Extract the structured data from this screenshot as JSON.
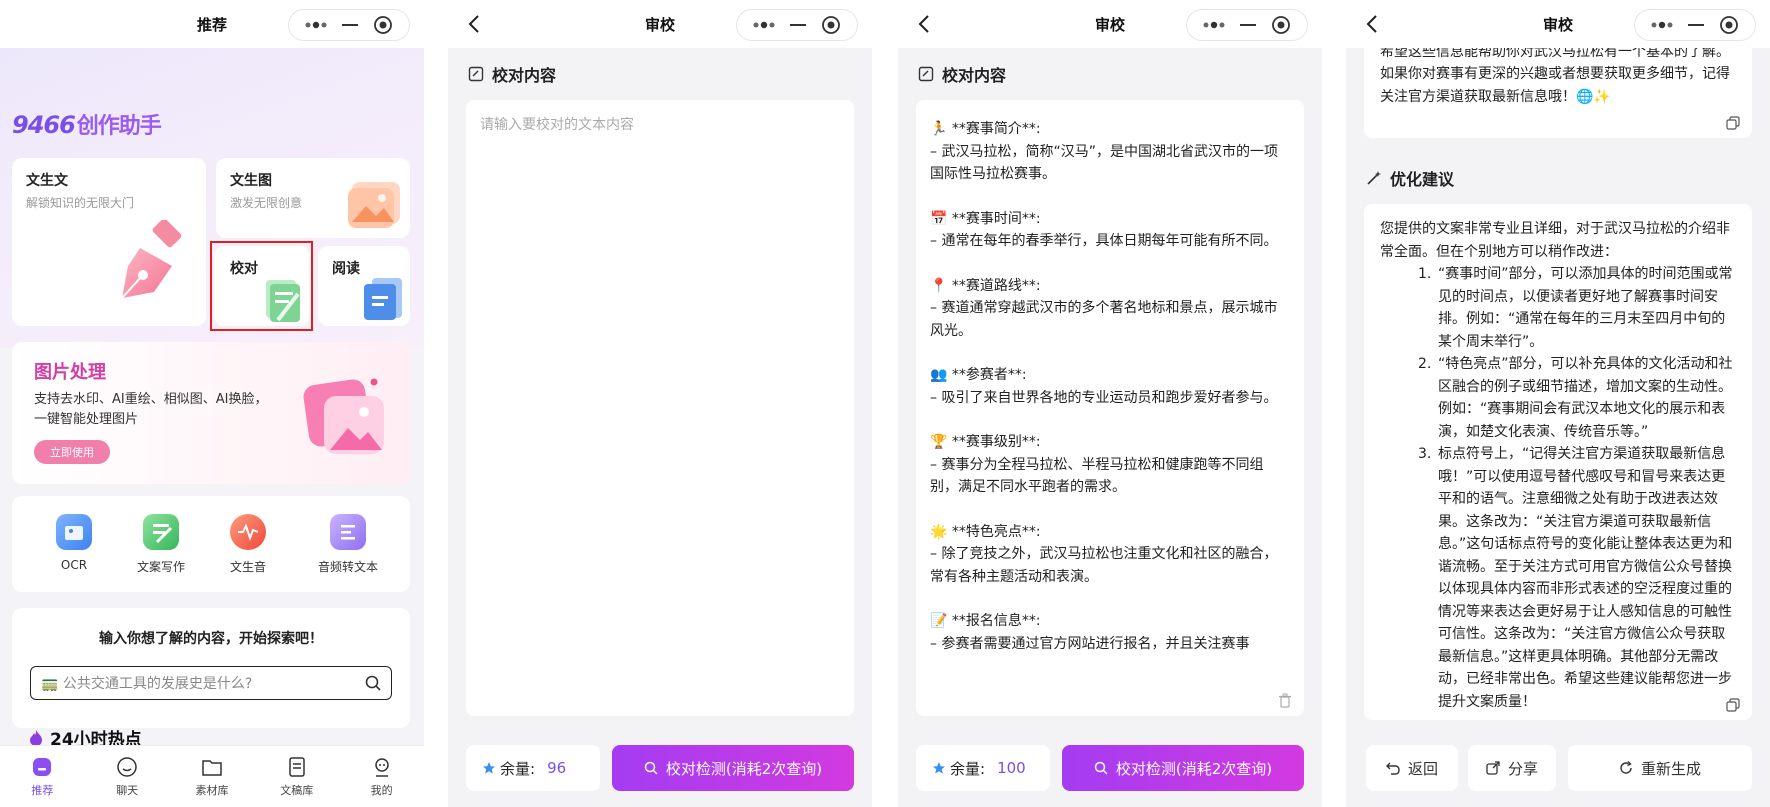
{
  "panel1": {
    "title": "推荐",
    "logo_num": "9466",
    "logo_text": "创作助手",
    "cards": {
      "wenshengwen": {
        "title": "文生文",
        "subtitle": "解锁知识的无限大门"
      },
      "wenshengtu": {
        "title": "文生图",
        "subtitle": "激发无限创意"
      },
      "jiaodui": {
        "title": "校对"
      },
      "yuedu": {
        "title": "阅读"
      }
    },
    "image_section": {
      "title": "图片处理",
      "desc": "支持去水印、AI重绘、相似图、AI换脸，一键智能处理图片",
      "button": "立即使用"
    },
    "tools": [
      {
        "label": "OCR",
        "icon": "ocr-icon",
        "color": "#4a90f0"
      },
      {
        "label": "文案写作",
        "icon": "writing-icon",
        "color": "#45c06a"
      },
      {
        "label": "文生音",
        "icon": "audio-icon",
        "color": "#f06048"
      },
      {
        "label": "音频转文本",
        "icon": "audio-to-text-icon",
        "color": "#9a7bf0"
      }
    ],
    "explore": {
      "title": "输入你想了解的内容，开始探索吧！",
      "placeholder": "🚃 公共交通工具的发展史是什么?"
    },
    "hot_title": "24小时热点",
    "tabbar": [
      {
        "label": "推荐",
        "icon": "home-icon"
      },
      {
        "label": "聊天",
        "icon": "chat-icon"
      },
      {
        "label": "素材库",
        "icon": "folder-icon"
      },
      {
        "label": "文稿库",
        "icon": "document-icon"
      },
      {
        "label": "我的",
        "icon": "profile-icon"
      }
    ]
  },
  "panel2": {
    "title": "审校",
    "section_title": "校对内容",
    "placeholder": "请输入要校对的文本内容",
    "remain_label": "余量:",
    "remain_value": "96",
    "check_button": "校对检测(消耗2次查询)"
  },
  "panel3": {
    "title": "审校",
    "section_title": "校对内容",
    "paragraphs": [
      {
        "head": "🏃 **赛事简介**:",
        "body": "– 武汉马拉松，简称“汉马”，是中国湖北省武汉市的一项国际性马拉松赛事。"
      },
      {
        "head": "📅 **赛事时间**:",
        "body": "– 通常在每年的春季举行，具体日期每年可能有所不同。"
      },
      {
        "head": "📍 **赛道路线**:",
        "body": "– 赛道通常穿越武汉市的多个著名地标和景点，展示城市风光。"
      },
      {
        "head": "👥 **参赛者**:",
        "body": "– 吸引了来自世界各地的专业运动员和跑步爱好者参与。"
      },
      {
        "head": "🏆 **赛事级别**:",
        "body": "– 赛事分为全程马拉松、半程马拉松和健康跑等不同组别，满足不同水平跑者的需求。"
      },
      {
        "head": "🌟 **特色亮点**:",
        "body": "– 除了竞技之外，武汉马拉松也注重文化和社区的融合，常有各种主题活动和表演。"
      },
      {
        "head": "📝 **报名信息**:",
        "body": "– 参赛者需要通过官方网站进行报名，并且关注赛事"
      }
    ],
    "remain_label": "余量:",
    "remain_value": "100",
    "check_button": "校对检测(消耗2次查询)"
  },
  "panel4": {
    "title": "审校",
    "top_text": "希望这些信息能帮助你对武汉马拉松有一个基本的了解。如果你对赛事有更深的兴趣或者想要获取更多细节，记得关注官方渠道获取最新信息哦！🌐✨",
    "section_title": "优化建议",
    "intro": "您提供的文案非常专业且详细，对于武汉马拉松的介绍非常全面。但在个别地方可以稍作改进：",
    "items": [
      {
        "n": "1.",
        "text": "“赛事时间”部分，可以添加具体的时间范围或常见的时间点，以便读者更好地了解赛事时间安排。例如：“通常在每年的三月末至四月中旬的某个周末举行”。"
      },
      {
        "n": "2.",
        "text": "“特色亮点”部分，可以补充具体的文化活动和社区融合的例子或细节描述，增加文案的生动性。例如：“赛事期间会有武汉本地文化的展示和表演，如楚文化表演、传统音乐等。”"
      },
      {
        "n": "3.",
        "text": "标点符号上，“记得关注官方渠道获取最新信息哦！”可以使用逗号替代感叹号和冒号来表达更平和的语气。注意细微之处有助于改进表达效果。这条改为：“关注官方渠道可获取最新信息。”这句话标点符号的变化能让整体表达更为和谐流畅。至于关注方式可用官方微信公众号替换以体现具体内容而非形式表述的空泛程度过重的情况等来表达会更好易于让人感知信息的可触性可信性。这条改为：“关注官方微信公众号获取最新信息。”这样更具体明确。其他部分无需改动，已经非常出色。希望这些建议能帮您进一步提升文案质量！"
      }
    ],
    "actions": [
      {
        "label": "返回",
        "icon": "return-icon"
      },
      {
        "label": "分享",
        "icon": "share-icon"
      },
      {
        "label": "重新生成",
        "icon": "refresh-icon"
      }
    ]
  }
}
